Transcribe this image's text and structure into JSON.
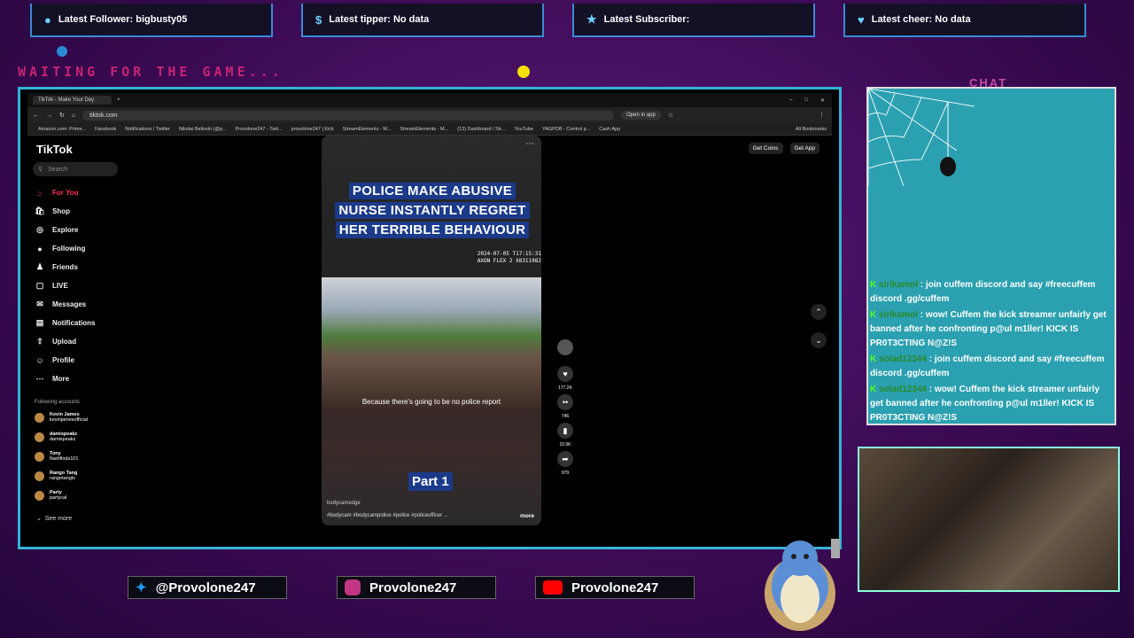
{
  "alerts": [
    {
      "icon": "person-icon",
      "text": "Latest Follower: bigbusty05"
    },
    {
      "icon": "dollar-icon",
      "text": "Latest tipper: No data"
    },
    {
      "icon": "star-icon",
      "text": "Latest Subscriber:"
    },
    {
      "icon": "heart-icon",
      "text": "Latest cheer: No data"
    }
  ],
  "waiting": "WAITING FOR THE GAME...",
  "chat_label": "CHAT",
  "browser": {
    "tab_title": "TikTok - Make Your Day",
    "url": "tiktok.com",
    "open_in_app": "Open in app",
    "bookmarks": [
      "Amazon.com: Prime...",
      "Facebook",
      "Notifications / Twitter",
      "Nikolai Belinski (@p...",
      "Provolone247 - Twit...",
      "provolone247 | Kick",
      "StreamElements - M...",
      "StreamElements - M...",
      "(13) Dashboard / Str...",
      "YouTube",
      "YAGPDB - Control p...",
      "Cash App"
    ],
    "all_bookmarks": "All Bookmarks"
  },
  "tiktok": {
    "logo": "TikTok",
    "search_placeholder": "Search",
    "nav": [
      "For You",
      "Shop",
      "Explore",
      "Following",
      "Friends",
      "LIVE",
      "Messages",
      "Notifications",
      "Upload",
      "Profile",
      "More"
    ],
    "following_header": "Following accounts",
    "accounts": [
      {
        "name": "Kevin James",
        "handle": "kevinjamesofficial"
      },
      {
        "name": "damispeakz",
        "handle": "damispeakz"
      },
      {
        "name": "Tony",
        "handle": "flashfinds101"
      },
      {
        "name": "Rango Tang",
        "handle": "rangotangtv"
      },
      {
        "name": "Party",
        "handle": "partycal"
      }
    ],
    "see_more": "See more",
    "get_coins": "Get Coins",
    "get_app": "Get App",
    "video": {
      "title_lines": [
        "POLICE MAKE ABUSIVE",
        "NURSE INSTANTLY REGRET",
        "HER TERRIBLE BEHAVIOUR"
      ],
      "timestamp": "2024-07-05 T17:15:31",
      "camera": "AXON FLEX 2 X8311982",
      "caption": "Because there's going to be no police report",
      "part": "Part 1",
      "user": "bodycamedge",
      "tags": "#bodycam #bodycampolice #police #policeofficer ...",
      "more": "more"
    },
    "actions": {
      "likes": "177.2K",
      "comments": "746",
      "saves": "10.5K",
      "shares": "979"
    }
  },
  "chat": [
    {
      "user": "sirikamol",
      "text": " : join cuffem discord and say #freecuffem discord .gg/cuffem"
    },
    {
      "user": "sirikamol",
      "text": " : wow! Cuffem the kick streamer unfairly get banned after he confronting p@ul m1ller! KICK IS PR0T3CTING N@Z!S"
    },
    {
      "user": "solad12344",
      "text": " : join cuffem discord and say #freecuffem discord .gg/cuffem"
    },
    {
      "user": "solad12344",
      "text": " : wow! Cuffem the kick streamer unfairly get banned after he confronting p@ul m1ller! KICK IS PR0T3CTING N@Z!S"
    }
  ],
  "socials": [
    {
      "icon": "twitter-icon",
      "handle": "@Provolone247",
      "color": "#1da1f2"
    },
    {
      "icon": "instagram-icon",
      "handle": "Provolone247",
      "color": "#c13584"
    },
    {
      "icon": "youtube-icon",
      "handle": "Provolone247",
      "color": "#ff0000"
    }
  ]
}
